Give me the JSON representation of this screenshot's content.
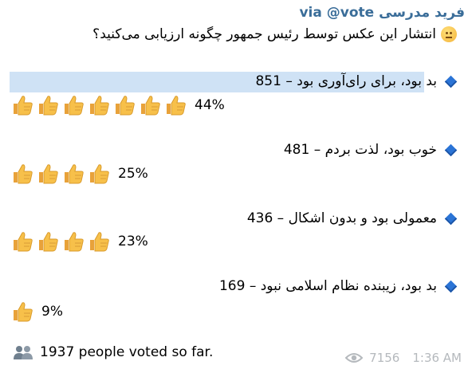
{
  "header": {
    "sender": "فرید مدرسی",
    "via_text": "via @vote"
  },
  "poll": {
    "question": "انتشار این عکس توسط رئیس جمهور چگونه ارزیابی می‌کنید؟",
    "options": [
      {
        "label": "بد بود، برای رای‌آوری بود – 851",
        "percent": "44%",
        "thumbs": 7,
        "highlighted": true
      },
      {
        "label": "خوب بود، لذت بردم – 481",
        "percent": "25%",
        "thumbs": 4,
        "highlighted": false
      },
      {
        "label": "معمولی بود و بدون اشکال – 436",
        "percent": "23%",
        "thumbs": 4,
        "highlighted": false
      },
      {
        "label": "بد بود، زیبنده نظام اسلامی نبود – 169",
        "percent": "9%",
        "thumbs": 1,
        "highlighted": false
      }
    ],
    "total_votes": "1937 people voted so far."
  },
  "meta": {
    "views": "7156",
    "time": "1:36 AM"
  },
  "colors": {
    "sender": "#3a6d99",
    "highlight": "#cfe2f5",
    "diamond": "#2b74d6",
    "meta": "#b5b9bd"
  },
  "icons": {
    "question": "slight-frown-face-icon",
    "option_bullet": "blue-diamond-icon",
    "vote_unit": "thumbs-up-icon",
    "voters": "people-icon",
    "views": "eye-icon"
  }
}
